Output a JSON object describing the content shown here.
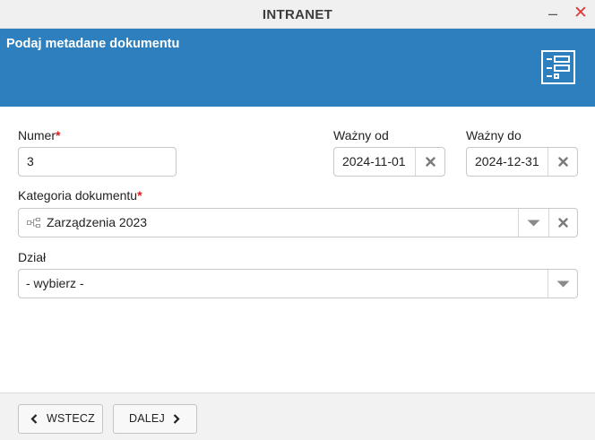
{
  "window": {
    "title": "INTRANET",
    "minimize_label": "–",
    "close_label": "✕"
  },
  "header": {
    "title": "Podaj metadane dokumentu",
    "icon": "form-list-icon"
  },
  "form": {
    "numer": {
      "label": "Numer",
      "required_mark": "*",
      "value": "3"
    },
    "wazny_od": {
      "label": "Ważny od",
      "value": "2024-11-01"
    },
    "wazny_do": {
      "label": "Ważny do",
      "value": "2024-12-31"
    },
    "kategoria": {
      "label": "Kategoria dokumentu",
      "required_mark": "*",
      "value": "Zarządzenia 2023",
      "icon": "sitemap-icon"
    },
    "dzial": {
      "label": "Dział",
      "value": "- wybierz -"
    }
  },
  "footer": {
    "back_label": "WSTECZ",
    "next_label": "DALEJ"
  },
  "colors": {
    "header_bg": "#2d80bd",
    "required": "#e01a1a",
    "close": "#e03b3b"
  }
}
